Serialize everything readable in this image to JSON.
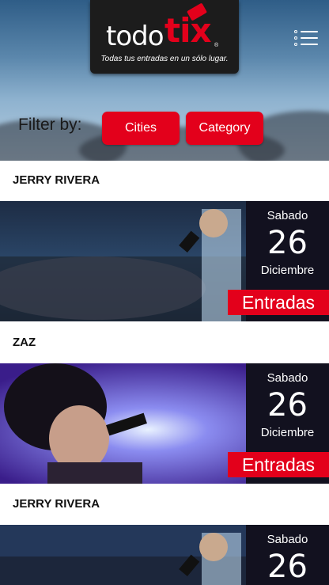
{
  "header": {
    "logo_todo": "todo",
    "logo_tix": "tix",
    "logo_reg": "®",
    "tagline": "Todas tus entradas en un sólo lugar.",
    "menu_icon": "list-menu-icon"
  },
  "filter": {
    "label": "Filter by:",
    "cities_label": "Cities",
    "category_label": "Category"
  },
  "events": [
    {
      "title": "JERRY RIVERA",
      "day": "Sabado",
      "date": "26",
      "month": "Diciembre",
      "cta": "Entradas"
    },
    {
      "title": "ZAZ",
      "day": "Sabado",
      "date": "26",
      "month": "Diciembre",
      "cta": "Entradas"
    },
    {
      "title": "JERRY RIVERA",
      "day": "Sabado",
      "date": "26"
    }
  ],
  "colors": {
    "brand_red": "#e3001b",
    "date_panel": "#12111f",
    "logo_bg": "#1c1c1c"
  }
}
